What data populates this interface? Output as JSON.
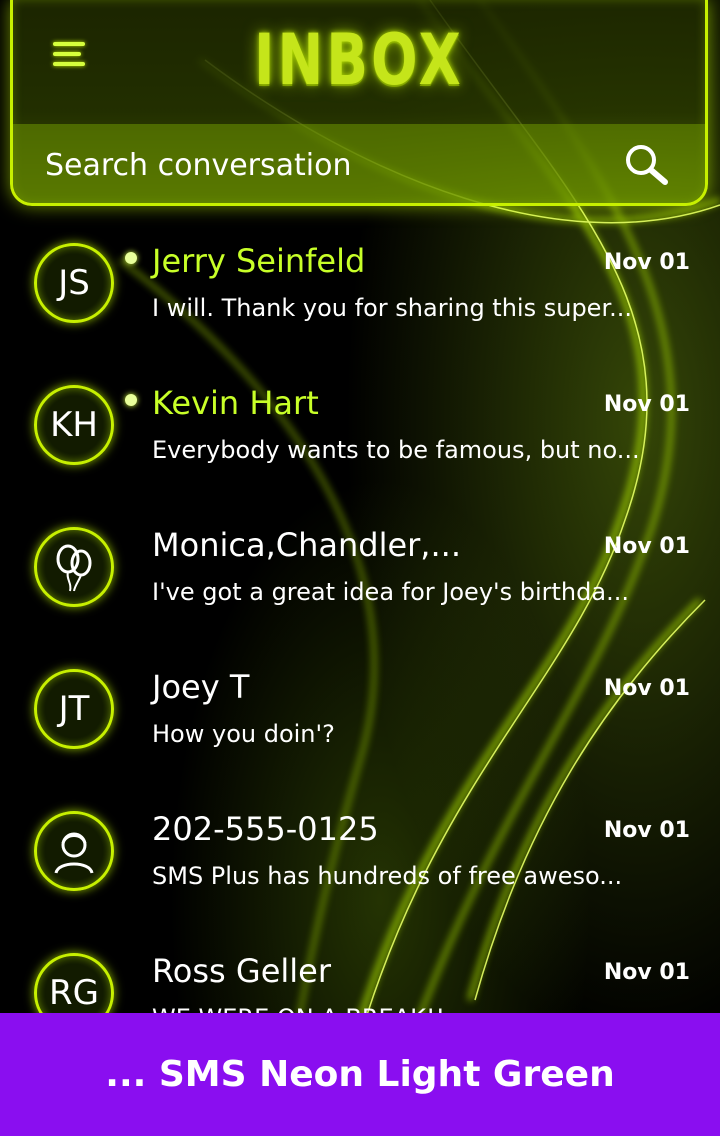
{
  "header": {
    "title": "INBOX",
    "menu_icon": "hamburger-menu-icon"
  },
  "search": {
    "placeholder": "Search conversation",
    "icon": "magnifier-icon"
  },
  "conversations": [
    {
      "avatar": "JS",
      "name": "Jerry Seinfeld",
      "date": "Nov 01",
      "preview": "I will. Thank you for sharing this super...",
      "unread": true
    },
    {
      "avatar": "KH",
      "name": "Kevin Hart",
      "date": "Nov 01",
      "preview": "Everybody wants to be famous, but no...",
      "unread": true
    },
    {
      "avatar": "balloons-icon",
      "name": "Monica,Chandler,...",
      "date": "Nov 01",
      "preview": "I've got a great idea for Joey's birthda...",
      "unread": false
    },
    {
      "avatar": "JT",
      "name": "Joey T",
      "date": "Nov 01",
      "preview": "How you doin'?",
      "unread": false
    },
    {
      "avatar": "person-icon",
      "name": "202-555-0125",
      "date": "Nov 01",
      "preview": "SMS Plus has hundreds of free aweso...",
      "unread": false
    },
    {
      "avatar": "RG",
      "name": "Ross Geller",
      "date": "Nov 01",
      "preview": "WE WERE ON A BREAK!!",
      "unread": false
    }
  ],
  "banner": {
    "text": "... SMS Neon Light Green"
  },
  "colors": {
    "neon": "#c7f000",
    "banner": "#8a0ef0",
    "unread_name": "#c8ff28"
  }
}
